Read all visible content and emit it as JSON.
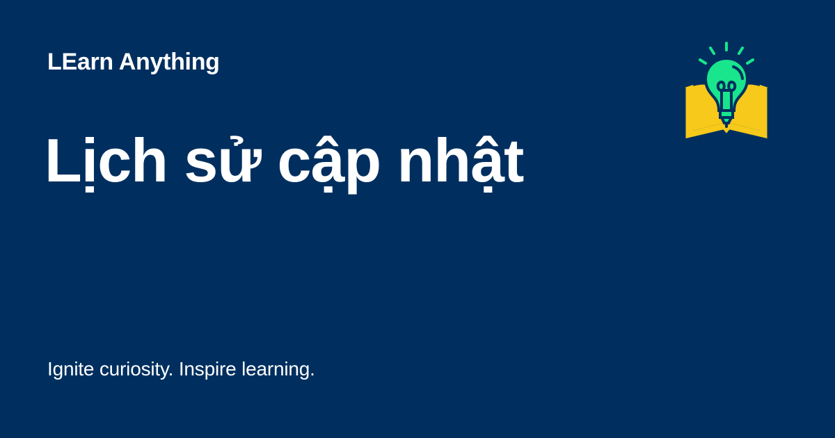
{
  "brand": {
    "name": "LEarn Anything",
    "logo_icon": "lightbulb-open-book-icon"
  },
  "page": {
    "title": "Lịch sử cập nhật",
    "tagline": "Ignite curiosity. Inspire learning."
  },
  "colors": {
    "background": "#002f5f",
    "text": "#ffffff",
    "book": "#f6c91a",
    "bulb": "#19e58c",
    "outline": "#002f5f"
  }
}
